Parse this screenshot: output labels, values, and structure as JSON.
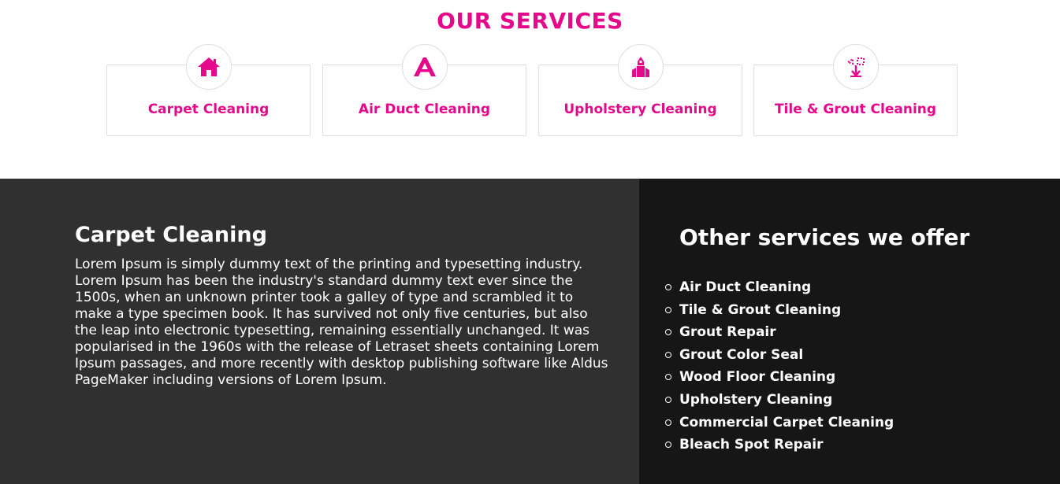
{
  "services_section": {
    "title": "OUR SERVICES",
    "cards": [
      {
        "label": "Carpet Cleaning",
        "icon": "house-icon"
      },
      {
        "label": "Air Duct Cleaning",
        "icon": "air-duct-icon"
      },
      {
        "label": "Upholstery Cleaning",
        "icon": "upholstery-icon"
      },
      {
        "label": "Tile & Grout Cleaning",
        "icon": "tile-grout-icon"
      }
    ]
  },
  "detail": {
    "title": "Carpet Cleaning",
    "body": "Lorem Ipsum is simply dummy text of the printing and typesetting industry. Lorem Ipsum has been the industry's standard dummy text ever since the 1500s, when an unknown printer took a galley of type and scrambled it to make a type specimen book. It has survived not only five centuries, but also the leap into electronic typesetting, remaining essentially unchanged. It was popularised in the 1960s with the release of Letraset sheets containing Lorem Ipsum passages, and more recently with desktop publishing software like Aldus PageMaker including versions of Lorem Ipsum."
  },
  "other_services": {
    "title": "Other services we offer",
    "items": [
      "Air Duct Cleaning",
      "Tile & Grout Cleaning",
      "Grout Repair",
      "Grout Color Seal",
      "Wood Floor Cleaning",
      "Upholstery Cleaning",
      "Commercial Carpet Cleaning",
      "Bleach Spot Repair"
    ]
  },
  "colors": {
    "accent": "#e5088b",
    "detail_bg": "#303030",
    "sidebar_bg": "#161616"
  }
}
